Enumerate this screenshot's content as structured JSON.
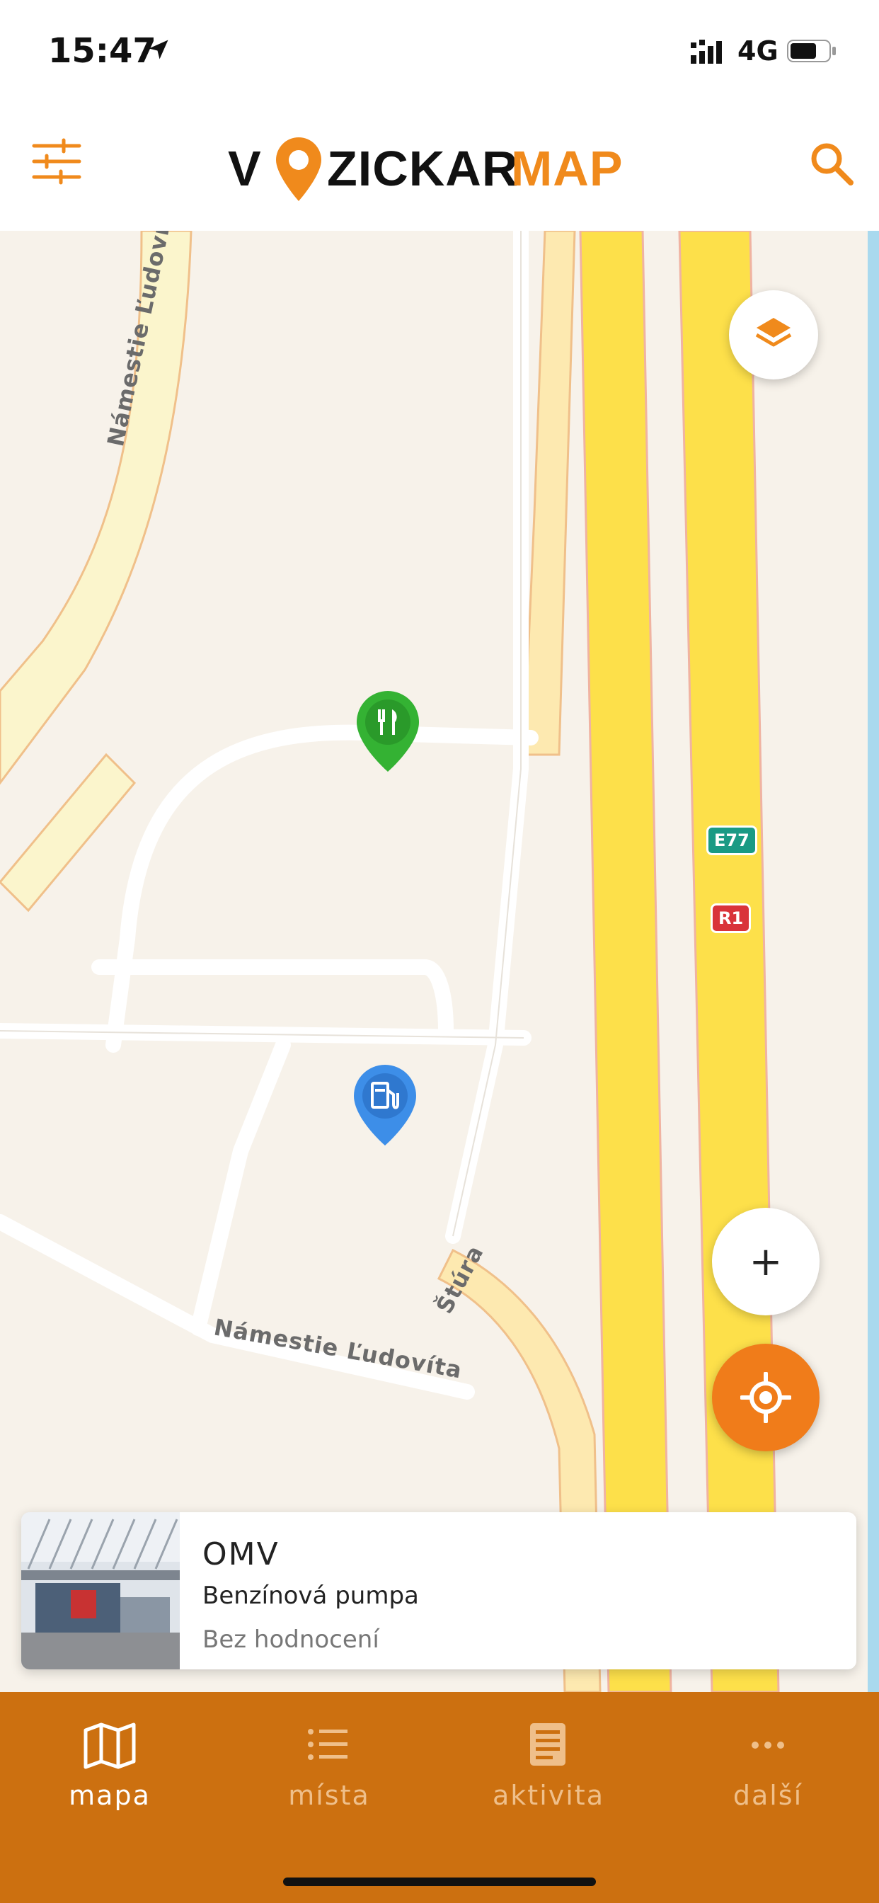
{
  "status_bar": {
    "time": "15:47",
    "network": "4G",
    "icons": [
      "location-arrow-icon",
      "signal-icon",
      "battery-icon"
    ]
  },
  "header": {
    "logo_text": "VOZICKARMAP",
    "filter_icon": "sliders-icon",
    "search_icon": "search-icon",
    "brand_color": "#f08a1c"
  },
  "map": {
    "road_labels": {
      "top": "Námestie Ľudovíta Š",
      "bottom_left": "Námestie Ľudovíta",
      "bottom_right": "Štúra"
    },
    "shields": {
      "e77": "E77",
      "r1": "R1"
    },
    "markers": [
      {
        "name": "restaurant-marker",
        "icon": "fork-knife-icon",
        "color": "#34b233"
      },
      {
        "name": "fuel-marker",
        "icon": "fuel-pump-icon",
        "color": "#3d8ee8"
      }
    ],
    "controls": {
      "layers_icon": "layers-icon",
      "zoom_in_label": "+",
      "locate_icon": "crosshair-icon"
    }
  },
  "place_card": {
    "title": "OMV",
    "type": "Benzínová pumpa",
    "rating": "Bez hodnocení"
  },
  "tabs": [
    {
      "label": "mapa",
      "icon": "map-icon",
      "active": true
    },
    {
      "label": "místa",
      "icon": "list-icon",
      "active": false
    },
    {
      "label": "aktivita",
      "icon": "feed-icon",
      "active": false
    },
    {
      "label": "další",
      "icon": "more-icon",
      "active": false
    }
  ],
  "colors": {
    "accent": "#f07c1a",
    "tabbar": "#cc7010",
    "highway": "#fde04a"
  }
}
